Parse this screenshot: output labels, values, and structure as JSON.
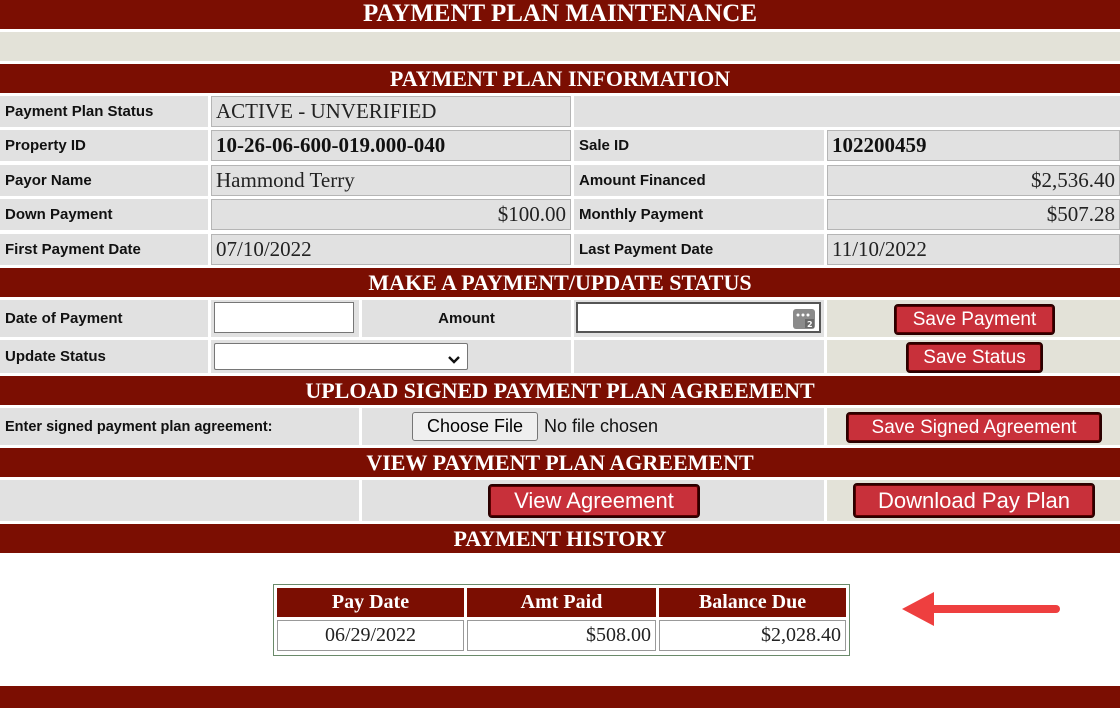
{
  "page_title": "PAYMENT PLAN MAINTENANCE",
  "sections": {
    "info": "PAYMENT PLAN INFORMATION",
    "make_payment": "MAKE A PAYMENT/UPDATE STATUS",
    "upload": "UPLOAD SIGNED PAYMENT PLAN AGREEMENT",
    "view": "VIEW PAYMENT PLAN AGREEMENT",
    "history": "PAYMENT HISTORY"
  },
  "info": {
    "status_label": "Payment Plan Status",
    "status_value": "ACTIVE - UNVERIFIED",
    "property_id_label": "Property ID",
    "property_id_value": "10-26-06-600-019.000-040",
    "sale_id_label": "Sale ID",
    "sale_id_value": "102200459",
    "payor_name_label": "Payor Name",
    "payor_name_value": "Hammond Terry",
    "amount_financed_label": "Amount Financed",
    "amount_financed_value": "$2,536.40",
    "down_payment_label": "Down Payment",
    "down_payment_value": "$100.00",
    "monthly_payment_label": "Monthly Payment",
    "monthly_payment_value": "$507.28",
    "first_payment_date_label": "First Payment Date",
    "first_payment_date_value": "07/10/2022",
    "last_payment_date_label": "Last Payment Date",
    "last_payment_date_value": "11/10/2022"
  },
  "payment": {
    "date_label": "Date of Payment",
    "date_value": "",
    "amount_label": "Amount",
    "amount_value": "",
    "save_payment": "Save Payment",
    "update_status_label": "Update Status",
    "update_status_selected": "",
    "save_status": "Save Status"
  },
  "upload": {
    "label": "Enter signed payment plan agreement:",
    "choose_file": "Choose File",
    "no_file": "No file chosen",
    "save_agreement": "Save Signed Agreement"
  },
  "view": {
    "view_agreement": "View Agreement",
    "download_plan": "Download Pay Plan"
  },
  "history": {
    "columns": [
      "Pay Date",
      "Amt Paid",
      "Balance Due"
    ],
    "rows": [
      [
        "06/29/2022",
        "$508.00",
        "$2,028.40"
      ]
    ]
  },
  "colors": {
    "header": "#7b0e02",
    "button": "#c8303a",
    "cell": "#e1e1e1",
    "arrow": "#ee3f3f"
  }
}
